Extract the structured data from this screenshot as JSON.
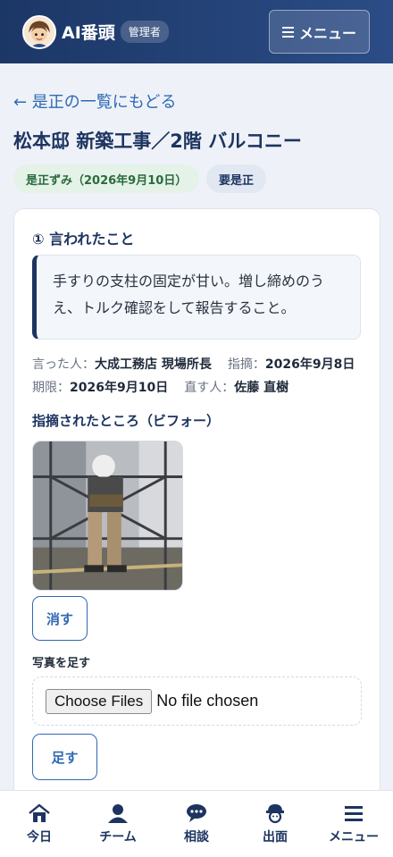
{
  "header": {
    "app_name": "AI番頭",
    "role_badge": "管理者",
    "menu_label": "メニュー"
  },
  "back_link": "← 是正の一覧にもどる",
  "page_title": "松本邸 新築工事／2階 バルコニー",
  "badges": {
    "done": "是正ずみ（2026年9月10日）",
    "need": "要是正"
  },
  "instruction": {
    "section_title": "① 言われたこと",
    "text": "手すりの支柱の固定が甘い。増し締めのうえ、トルク確認をして報告すること。"
  },
  "meta": {
    "said_by_label": "言った人：",
    "said_by": "大成工務店 現場所長",
    "pointed_label": "指摘：",
    "pointed_date": "2026年9月8日",
    "deadline_label": "期限：",
    "deadline": "2026年9月10日",
    "fixer_label": "直す人：",
    "fixer": "佐藤 直樹"
  },
  "before_photo": {
    "title": "指摘されたところ（ビフォー）",
    "delete_label": "消す"
  },
  "add_photo": {
    "label": "写真を足す",
    "file_button": "Choose Files",
    "file_status": "No file chosen",
    "submit_label": "足す"
  },
  "bottom_nav": {
    "today": "今日",
    "team": "チーム",
    "consult": "相談",
    "attendance": "出面",
    "menu": "メニュー"
  },
  "colors": {
    "header_navy": "#1c3766",
    "accent_blue": "#2f69b4",
    "done_green": "#2a6b3c"
  }
}
